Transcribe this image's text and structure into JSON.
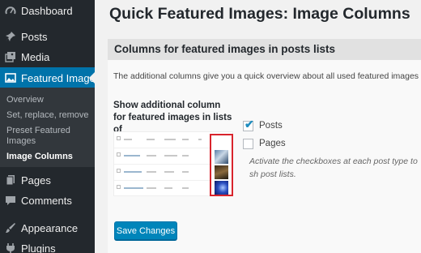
{
  "sidebar": {
    "items": [
      {
        "label": "Dashboard",
        "icon": "dashboard-icon"
      },
      {
        "label": "Posts",
        "icon": "pin-icon"
      },
      {
        "label": "Media",
        "icon": "media-icon"
      },
      {
        "label": "Featured Images",
        "icon": "image-icon"
      },
      {
        "label": "Pages",
        "icon": "pages-icon"
      },
      {
        "label": "Comments",
        "icon": "comment-icon"
      },
      {
        "label": "Appearance",
        "icon": "brush-icon"
      },
      {
        "label": "Plugins",
        "icon": "plug-icon"
      }
    ],
    "submenu": [
      {
        "label": "Overview"
      },
      {
        "label": "Set, replace, remove"
      },
      {
        "label": "Preset Featured Images"
      },
      {
        "label": "Image Columns"
      }
    ],
    "active_color": "#0073aa",
    "background": "#23282d"
  },
  "main": {
    "title": "Quick Featured Images: Image Columns",
    "section_title": "Columns for featured images in posts lists",
    "intro": "The additional columns give you a quick overview about all used featured images for",
    "option_label": "Show additional column for featured images in lists of",
    "checkboxes": [
      {
        "label": "Posts",
        "checked": true
      },
      {
        "label": "Pages",
        "checked": false
      }
    ],
    "help": "Activate the checkboxes at each post type to sh post lists.",
    "save_label": "Save Changes",
    "accent": "#0085ba",
    "highlight": "#d8242c"
  }
}
